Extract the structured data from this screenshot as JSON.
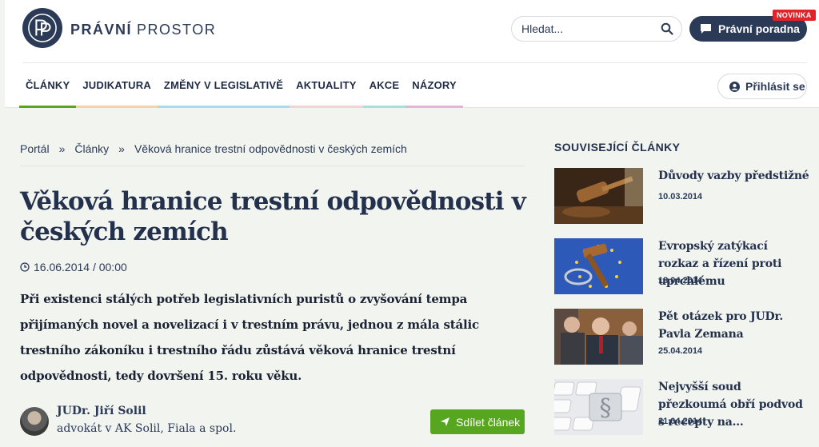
{
  "header": {
    "brand_bold": "PRÁVNÍ",
    "brand_light": "PROSTOR",
    "search_placeholder": "Hledat...",
    "advice_label": "Právní poradna",
    "advice_badge": "NOVINKA",
    "login_label": "Přihlásit se"
  },
  "nav": {
    "items": [
      {
        "label": "ČLÁNKY",
        "color": "#57a620"
      },
      {
        "label": "JUDIKATURA",
        "color": "#f5d4a4"
      },
      {
        "label": "ZMĚNY V LEGISLATIVĚ",
        "color": "#a9d9ec"
      },
      {
        "label": "AKTUALITY",
        "color": "#f2d3d6"
      },
      {
        "label": "AKCE",
        "color": "#a8dfd6"
      },
      {
        "label": "NÁZORY",
        "color": "#e3b4d6"
      }
    ]
  },
  "breadcrumb": {
    "items": [
      "Portál",
      "Články",
      "Věková hranice trestní odpovědnosti v českých zemích"
    ],
    "separator": "»"
  },
  "article": {
    "title": "Věková hranice trestní odpovědnosti v českých zemích",
    "date": "16.06.2014 / 00:00",
    "lead": "Při existenci stálých potřeb legislativních puristů o zvyšování tempa přijímaných novel a novelizací i v trestním právu, jednou z mála stálic trestního zákoníku i trestního řádu zůstává věková hranice trestní odpovědnosti, tedy dovršení 15. roku věku.",
    "author_name": "JUDr. Jiří Solil",
    "author_role": "advokát v AK Solil, Fiala a spol.",
    "share_label": "Sdílet článek"
  },
  "sidebar": {
    "heading": "SOUVISEJÍCÍ ČLÁNKY",
    "items": [
      {
        "title": "Důvody vazby předstižné",
        "date": "10.03.2014",
        "thumb": "gavel-icon"
      },
      {
        "title": "Evropský zatýkací rozkaz a řízení proti uprchlému",
        "date": "18.04.2014",
        "thumb": "eu-gavel-icon"
      },
      {
        "title": "Pět otázek pro JUDr. Pavla Zemana",
        "date": "25.04.2014",
        "thumb": "people-photo"
      },
      {
        "title": "Nejvyšší soud přezkoumá obří podvod s recepty na...",
        "date": "21.04.2014",
        "thumb": "keyboard-paragraph-icon"
      }
    ]
  }
}
